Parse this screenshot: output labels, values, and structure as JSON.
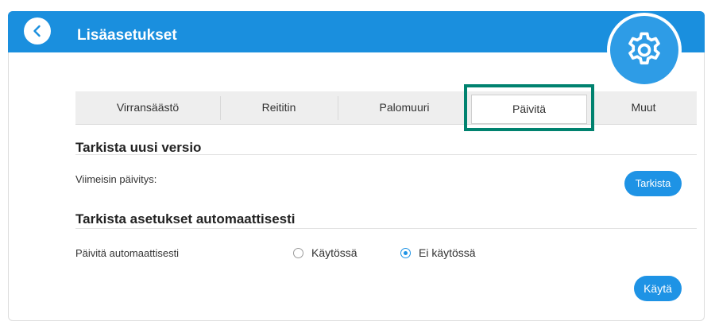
{
  "header": {
    "title": "Lisäasetukset"
  },
  "tabs": [
    {
      "label": "Virransäästö"
    },
    {
      "label": "Reititin"
    },
    {
      "label": "Palomuuri"
    },
    {
      "label": "Päivitä"
    },
    {
      "label": "Muut"
    }
  ],
  "active_tab": "Päivitä",
  "check_section": {
    "heading": "Tarkista uusi versio",
    "last_update_label": "Viimeisin päivitys:",
    "check_button": "Tarkista"
  },
  "auto_section": {
    "heading": "Tarkista asetukset automaattisesti",
    "auto_update_label": "Päivitä automaattisesti",
    "option_enabled": "Käytössä",
    "option_disabled": "Ei käytössä",
    "selected": "Ei käytössä",
    "apply_button": "Käytä"
  },
  "colors": {
    "accent": "#1a8fde",
    "highlight": "#00826f"
  }
}
